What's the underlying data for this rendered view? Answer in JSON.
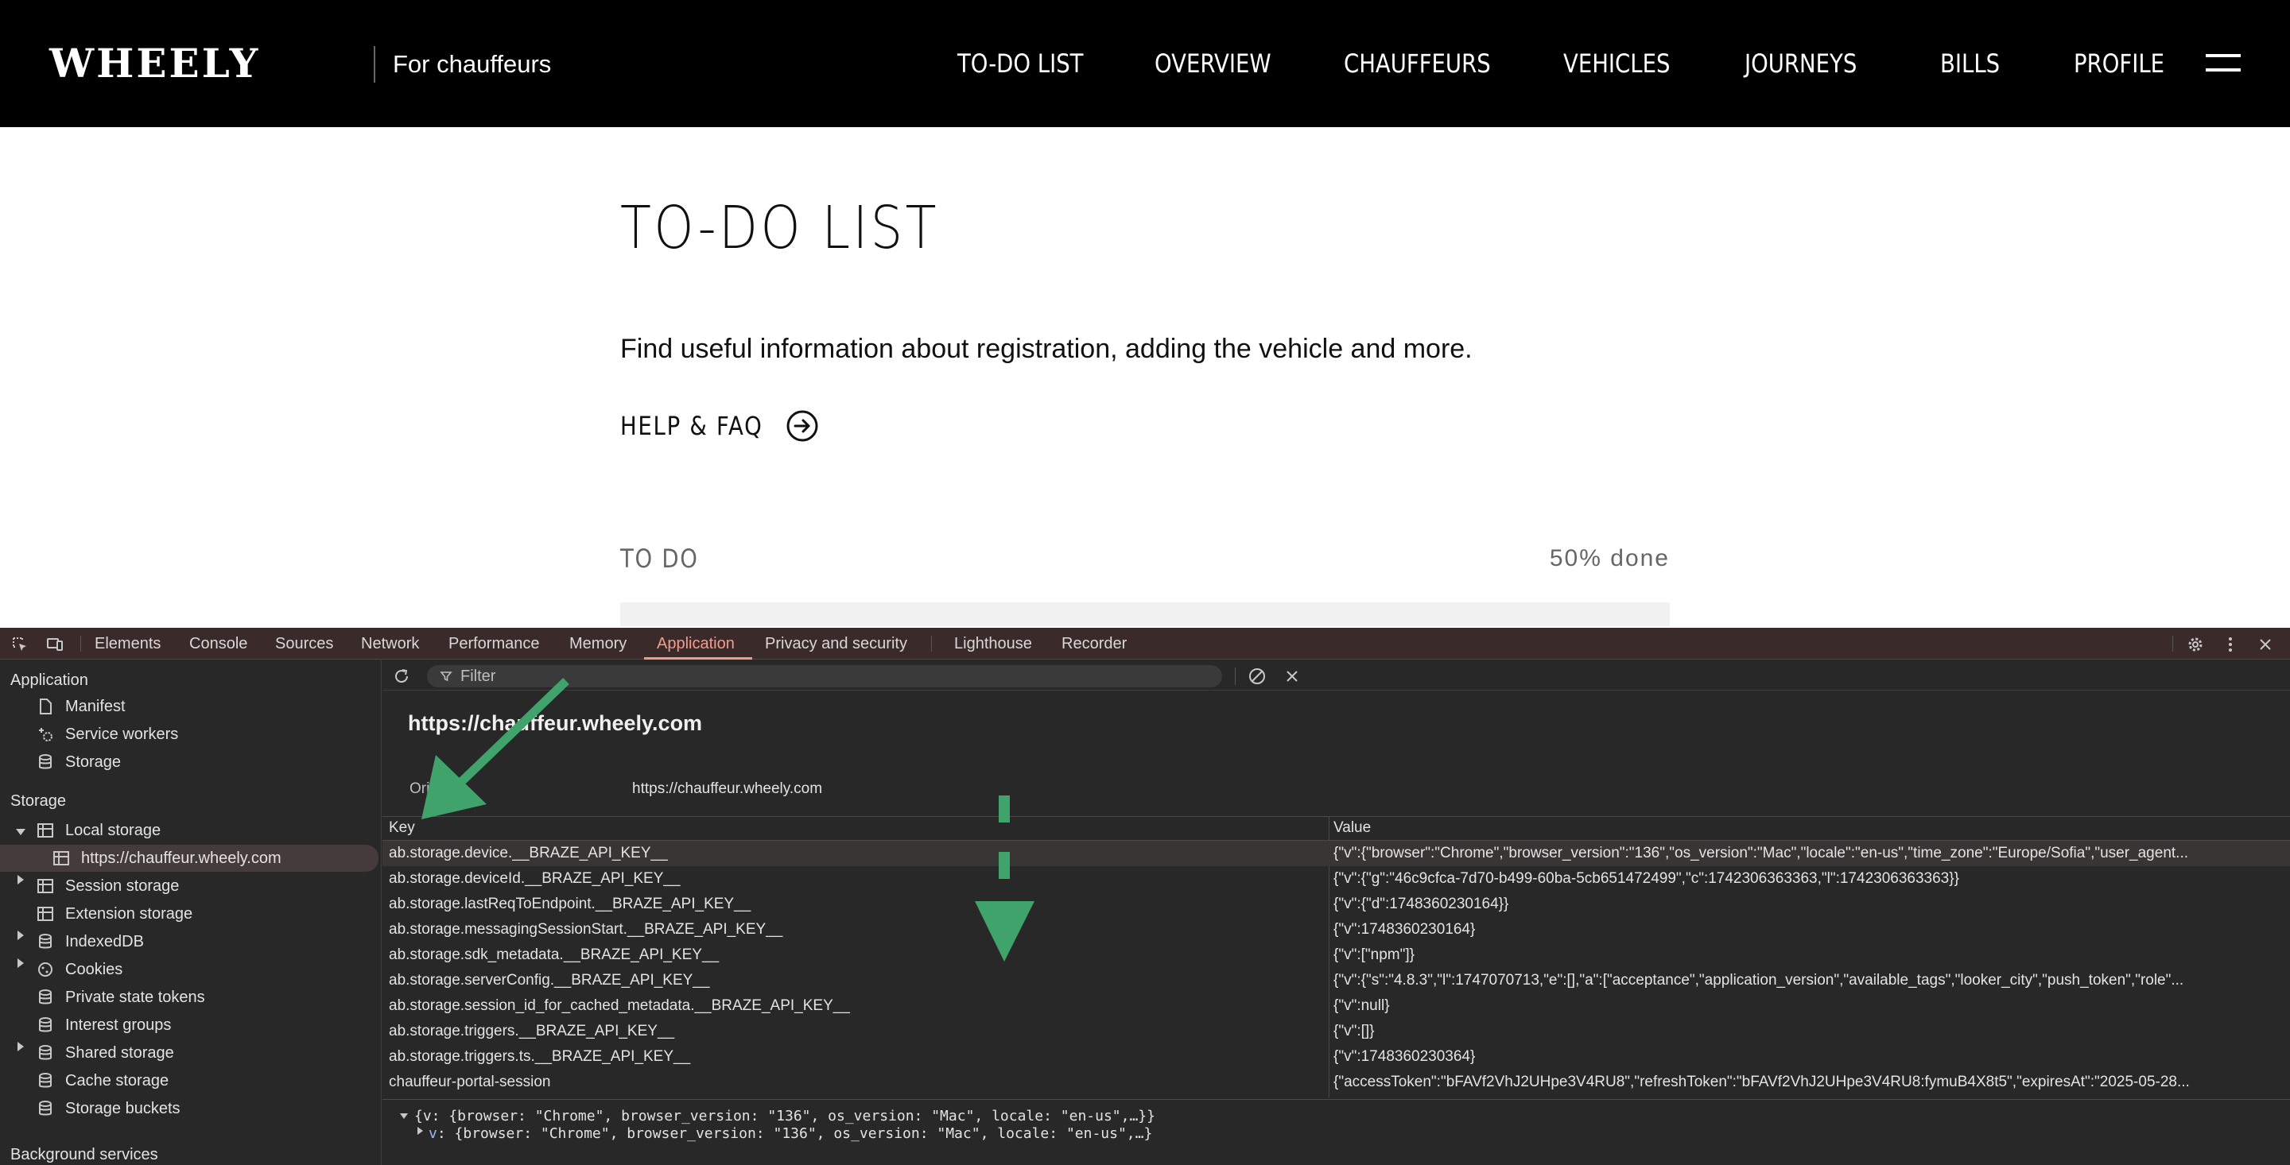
{
  "site": {
    "logo": "WHEELY",
    "tagline": "For chauffeurs",
    "nav": [
      "TO-DO LIST",
      "OVERVIEW",
      "CHAUFFEURS",
      "VEHICLES",
      "JOURNEYS",
      "BILLS",
      "PROFILE"
    ]
  },
  "page": {
    "title": "TO-DO LIST",
    "intro": "Find useful information about registration, adding the vehicle and more.",
    "help_label": "HELP & FAQ",
    "todo_label": "TO DO",
    "todo_progress": "50% done",
    "todo_progress_value": 0.5
  },
  "devtools": {
    "tabs": [
      "Elements",
      "Console",
      "Sources",
      "Network",
      "Performance",
      "Memory",
      "Application",
      "Privacy and security",
      "Lighthouse",
      "Recorder"
    ],
    "active_tab": "Application",
    "sidebar": {
      "application_heading": "Application",
      "application_items": [
        "Manifest",
        "Service workers",
        "Storage"
      ],
      "storage_heading": "Storage",
      "local_storage": "Local storage",
      "local_storage_origin": "https://chauffeur.wheely.com",
      "storage_items": [
        "Session storage",
        "Extension storage",
        "IndexedDB",
        "Cookies",
        "Private state tokens",
        "Interest groups",
        "Shared storage",
        "Cache storage",
        "Storage buckets"
      ],
      "background_services": "Background services"
    },
    "filter_placeholder": "Filter",
    "origin_title": "https://chauffeur.wheely.com",
    "origin_label": "Origin",
    "origin_value": "https://chauffeur.wheely.com",
    "table": {
      "key_header": "Key",
      "value_header": "Value",
      "rows": [
        {
          "key": "ab.storage.device.__BRAZE_API_KEY__",
          "value": "{\"v\":{\"browser\":\"Chrome\",\"browser_version\":\"136\",\"os_version\":\"Mac\",\"locale\":\"en-us\",\"time_zone\":\"Europe/Sofia\",\"user_agent..."
        },
        {
          "key": "ab.storage.deviceId.__BRAZE_API_KEY__",
          "value": "{\"v\":{\"g\":\"46c9cfca-7d70-b499-60ba-5cb651472499\",\"c\":1742306363363,\"l\":1742306363363}}"
        },
        {
          "key": "ab.storage.lastReqToEndpoint.__BRAZE_API_KEY__",
          "value": "{\"v\":{\"d\":1748360230164}}"
        },
        {
          "key": "ab.storage.messagingSessionStart.__BRAZE_API_KEY__",
          "value": "{\"v\":1748360230164}"
        },
        {
          "key": "ab.storage.sdk_metadata.__BRAZE_API_KEY__",
          "value": "{\"v\":[\"npm\"]}"
        },
        {
          "key": "ab.storage.serverConfig.__BRAZE_API_KEY__",
          "value": "{\"v\":{\"s\":\"4.8.3\",\"l\":1747070713,\"e\":[],\"a\":[\"acceptance\",\"application_version\",\"available_tags\",\"looker_city\",\"push_token\",\"role\"..."
        },
        {
          "key": "ab.storage.session_id_for_cached_metadata.__BRAZE_API_KEY__",
          "value": "{\"v\":null}"
        },
        {
          "key": "ab.storage.triggers.__BRAZE_API_KEY__",
          "value": "{\"v\":[]}"
        },
        {
          "key": "ab.storage.triggers.ts.__BRAZE_API_KEY__",
          "value": "{\"v\":1748360230364}"
        },
        {
          "key": "chauffeur-portal-session",
          "value": "{\"accessToken\":\"bFAVf2VhJ2UHpe3V4RU8\",\"refreshToken\":\"bFAVf2VhJ2UHpe3V4RU8:fymuB4X8t5\",\"expiresAt\":\"2025-05-28..."
        }
      ]
    },
    "preview": {
      "line1": "{v: {browser: \"Chrome\", browser_version: \"136\", os_version: \"Mac\", locale: \"en-us\",…}}",
      "line2_prop": "v",
      "line2_rest": ": {browser: \"Chrome\", browser_version: \"136\", os_version: \"Mac\", locale: \"en-us\",…}"
    }
  },
  "colors": {
    "annotation": "#3fa36b",
    "devtools_bg": "#282828",
    "active_tab": "#f29c8c"
  }
}
